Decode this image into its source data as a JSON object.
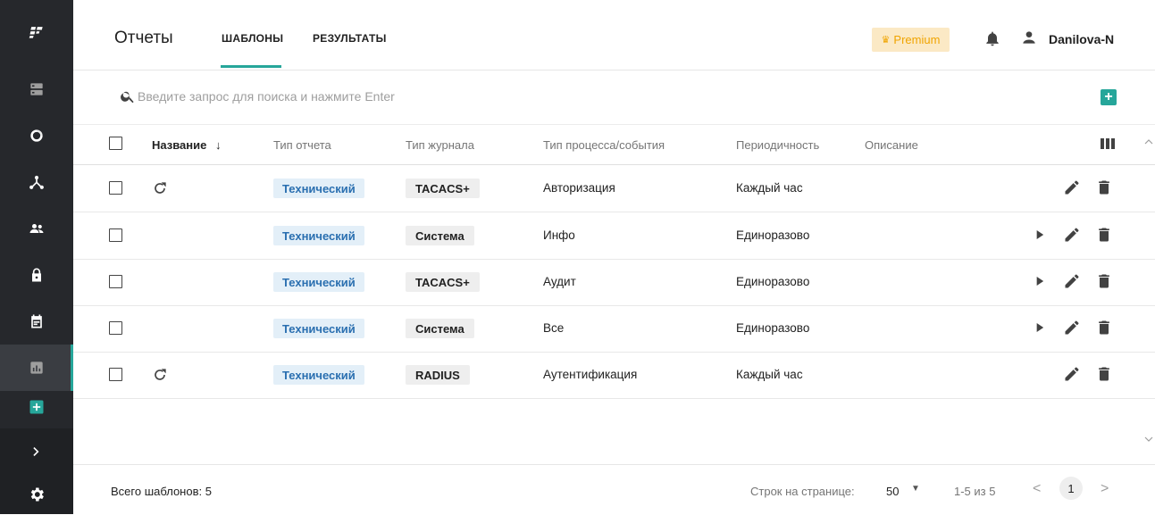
{
  "sidebar": {
    "items": [
      {
        "icon": "logo-icon"
      },
      {
        "icon": "servers-icon"
      },
      {
        "icon": "circle-icon"
      },
      {
        "icon": "network-icon"
      },
      {
        "icon": "users-icon"
      },
      {
        "icon": "lock-icon"
      },
      {
        "icon": "calendar-icon"
      },
      {
        "icon": "reports-icon",
        "active": true
      },
      {
        "icon": "add-icon"
      },
      {
        "icon": "chevron-right-icon"
      },
      {
        "icon": "settings-icon"
      }
    ]
  },
  "header": {
    "title": "Отчеты",
    "tabs": [
      {
        "label": "ШАБЛОНЫ",
        "active": true
      },
      {
        "label": "РЕЗУЛЬТАТЫ",
        "active": false
      }
    ],
    "premium_label": "Premium",
    "username": "Danilova-N"
  },
  "search": {
    "placeholder": "Введите запрос для поиска и нажмите Enter",
    "value": ""
  },
  "table": {
    "columns": [
      "Название",
      "Тип отчета",
      "Тип журнала",
      "Тип процесса/события",
      "Периодичность",
      "Описание"
    ],
    "sort_column": "Название",
    "sort_direction": "desc",
    "rows": [
      {
        "repeat": true,
        "report_type": "Технический",
        "log_type": "TACACS+",
        "process": "Авторизация",
        "period": "Каждый час",
        "description": "",
        "runnable": false
      },
      {
        "repeat": false,
        "report_type": "Технический",
        "log_type": "Система",
        "process": "Инфо",
        "period": "Единоразово",
        "description": "",
        "runnable": true
      },
      {
        "repeat": false,
        "report_type": "Технический",
        "log_type": "TACACS+",
        "process": "Аудит",
        "period": "Единоразово",
        "description": "",
        "runnable": true
      },
      {
        "repeat": false,
        "report_type": "Технический",
        "log_type": "Система",
        "process": "Все",
        "period": "Единоразово",
        "description": "",
        "runnable": true
      },
      {
        "repeat": true,
        "report_type": "Технический",
        "log_type": "RADIUS",
        "process": "Аутентификация",
        "period": "Каждый час",
        "description": "",
        "runnable": false
      }
    ]
  },
  "footer": {
    "total_label": "Всего шаблонов: 5",
    "rows_per_page_label": "Строк на странице:",
    "rows_per_page_value": "50",
    "range_label": "1-5 из 5",
    "current_page": "1"
  },
  "colors": {
    "accent": "#26a69a",
    "sidebar_bg": "#26282c",
    "premium_bg": "#fbe9c5",
    "premium_text": "#f0a400",
    "chip_blue_bg": "#e3eff8",
    "chip_blue_text": "#2a6fb0"
  }
}
